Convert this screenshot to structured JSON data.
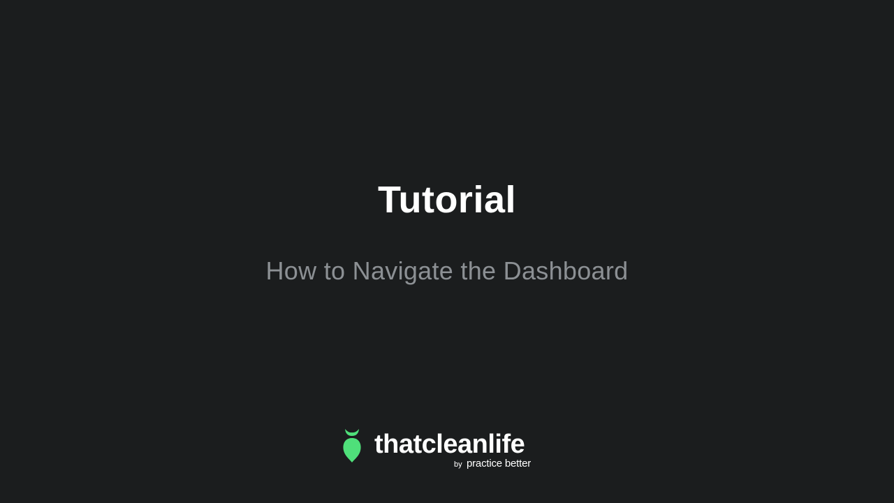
{
  "slide": {
    "title": "Tutorial",
    "subtitle": "How to Navigate the Dashboard"
  },
  "brand": {
    "name": "thatcleanlife",
    "by": "by",
    "parent": "practice better",
    "logo_icon": "radish-leaf-icon",
    "accent_color": "#4fe07a"
  },
  "colors": {
    "background": "#1b1d1e",
    "title": "#ffffff",
    "subtitle": "#8c9094"
  }
}
